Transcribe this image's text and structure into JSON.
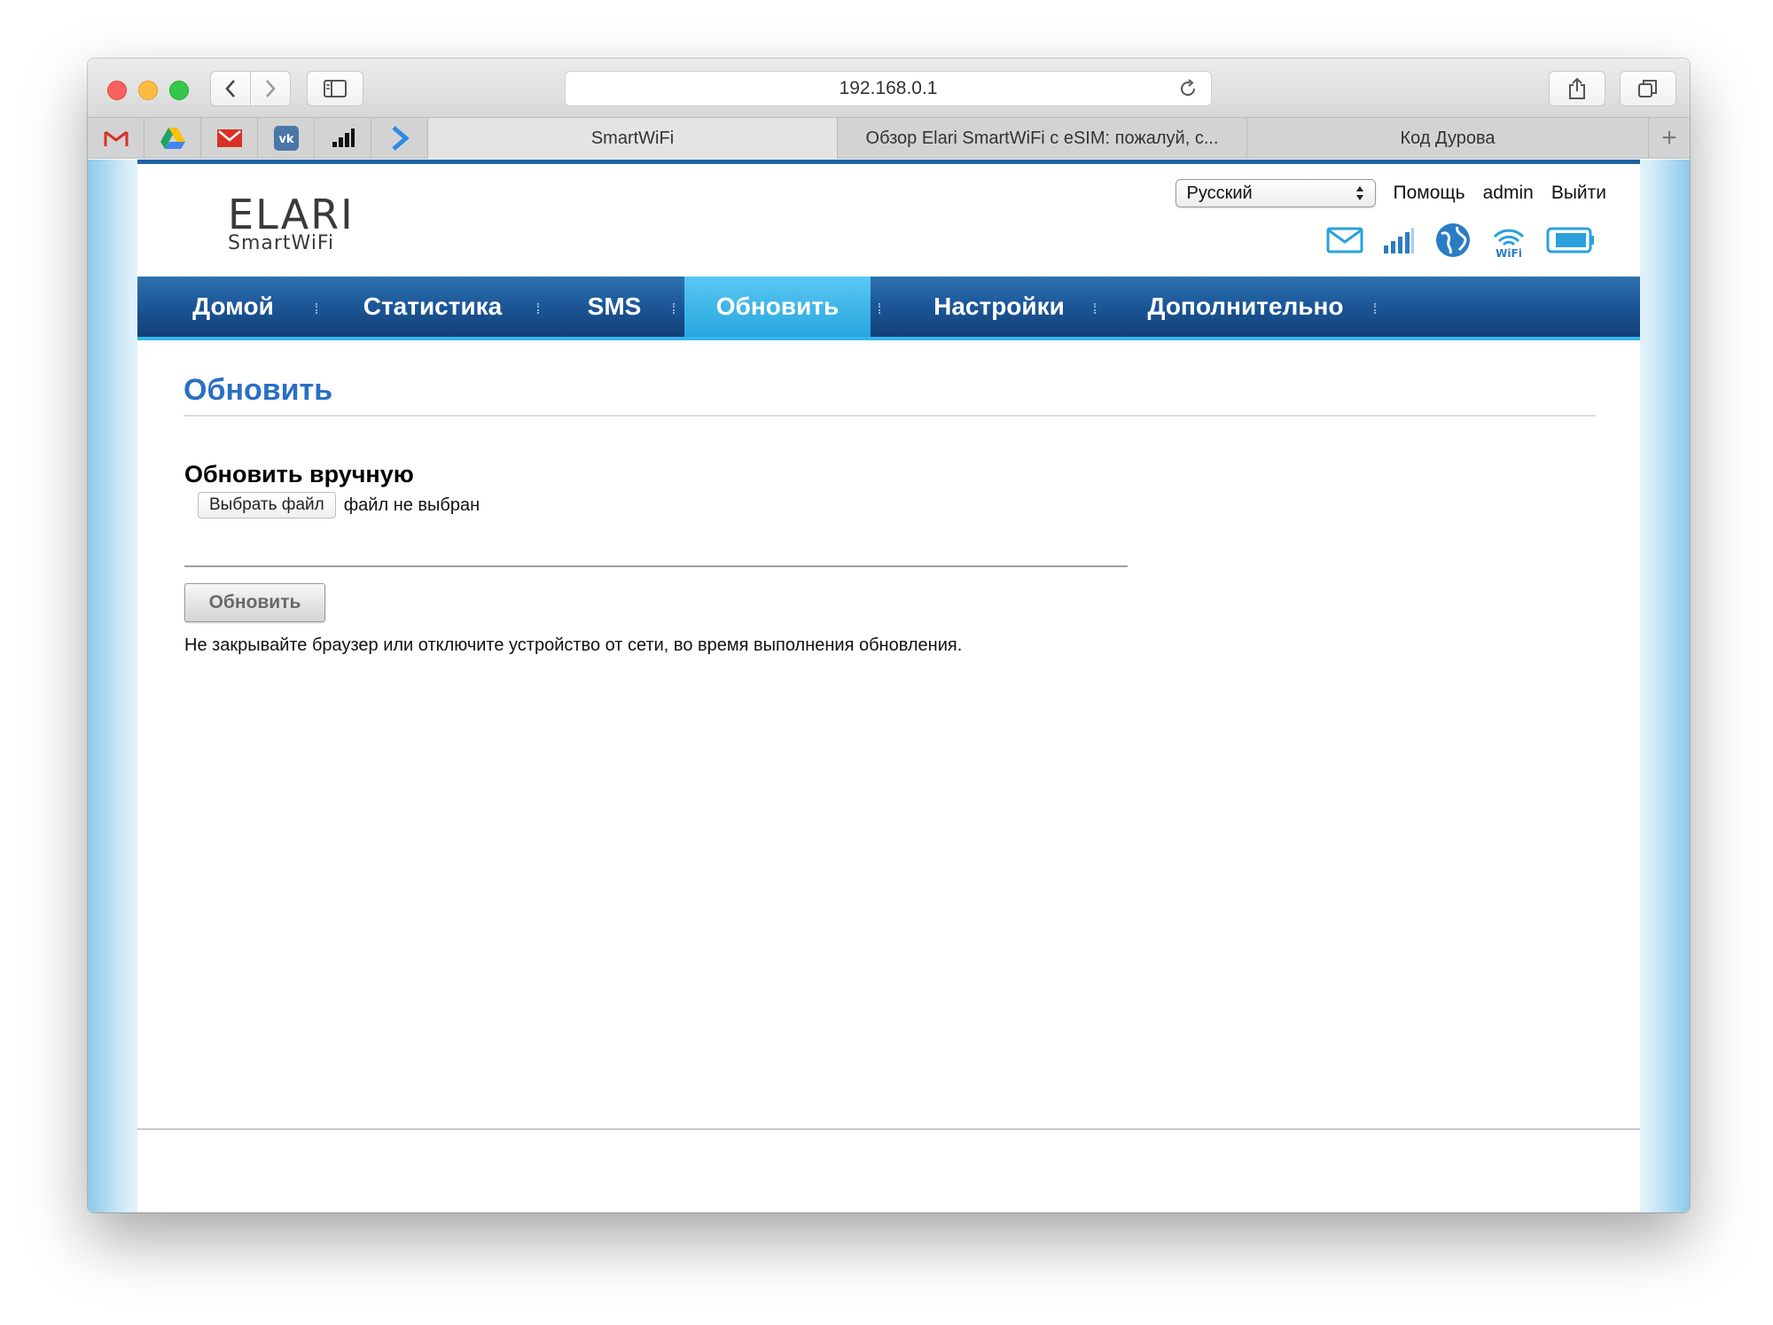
{
  "browser": {
    "address": "192.168.0.1",
    "tabs": [
      {
        "label": "SmartWiFi",
        "active": true
      },
      {
        "label": "Обзор Elari SmartWiFi с eSIM: пожалуй, с...",
        "active": false
      },
      {
        "label": "Код Дурова",
        "active": false
      }
    ],
    "new_tab": "+"
  },
  "header": {
    "logo_main": "ELARI",
    "logo_sub": "SmartWiFi",
    "language": "Русский",
    "help": "Помощь",
    "user": "admin",
    "logout": "Выйти"
  },
  "nav": {
    "items": [
      "Домой",
      "Статистика",
      "SMS",
      "Обновить",
      "Настройки",
      "Дополнительно"
    ],
    "active": "Обновить"
  },
  "content": {
    "title": "Обновить",
    "section_title": "Обновить вручную",
    "choose_file": "Выбрать файл",
    "file_status": "файл не выбран",
    "update_button": "Обновить",
    "warning": "Не закрывайте браузер или отключите устройство от сети, во время выполнения обновления."
  },
  "colors": {
    "nav_bar": "#1b5697",
    "nav_active": "#28a6de",
    "title": "#2a6fc4"
  }
}
